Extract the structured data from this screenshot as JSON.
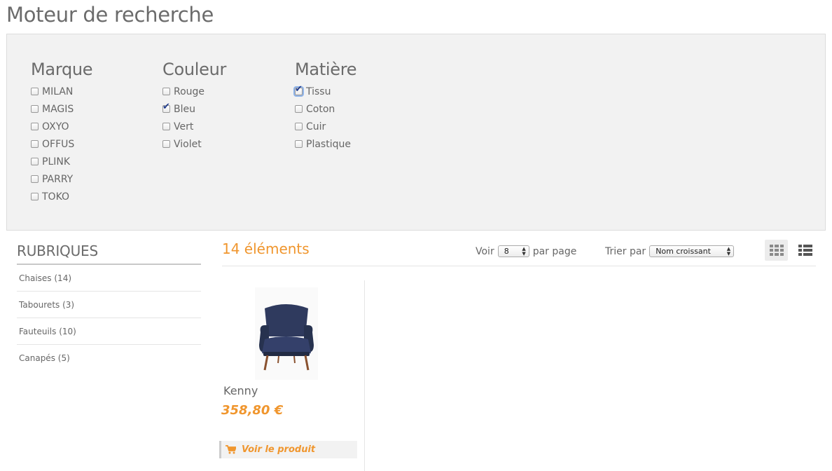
{
  "page_title": "Moteur de recherche",
  "filters": {
    "marque": {
      "title": "Marque",
      "options": [
        {
          "label": "MILAN",
          "checked": false
        },
        {
          "label": "MAGIS",
          "checked": false
        },
        {
          "label": "OXYO",
          "checked": false
        },
        {
          "label": "OFFUS",
          "checked": false
        },
        {
          "label": "PLINK",
          "checked": false
        },
        {
          "label": "PARRY",
          "checked": false
        },
        {
          "label": "TOKO",
          "checked": false
        }
      ]
    },
    "couleur": {
      "title": "Couleur",
      "options": [
        {
          "label": "Rouge",
          "checked": false
        },
        {
          "label": "Bleu",
          "checked": true
        },
        {
          "label": "Vert",
          "checked": false
        },
        {
          "label": "Violet",
          "checked": false
        }
      ]
    },
    "matiere": {
      "title": "Matière",
      "options": [
        {
          "label": "Tissu",
          "checked": true
        },
        {
          "label": "Coton",
          "checked": false
        },
        {
          "label": "Cuir",
          "checked": false
        },
        {
          "label": "Plastique",
          "checked": false
        }
      ]
    }
  },
  "sidebar": {
    "title": "RUBRIQUES",
    "categories": [
      "Chaises (14)",
      "Tabourets (3)",
      "Fauteuils (10)",
      "Canapés (5)"
    ]
  },
  "toolbar": {
    "count": "14 éléments",
    "voir_label": "Voir",
    "per_page_value": "8",
    "per_page_suffix": "par page",
    "sort_label": "Trier par",
    "sort_value": "Nom croissant",
    "grid_icon": "grid-view-icon",
    "list_icon": "list-view-icon"
  },
  "products": [
    {
      "name": "Kenny",
      "price": "358,80 €",
      "button_label": "Voir le produit",
      "image_icon": "armchair-image"
    }
  ],
  "colors": {
    "accent": "#f0962e",
    "panel_bg": "#f2f2f2",
    "text": "#666666",
    "chair_fabric": "#2f3a5e"
  }
}
